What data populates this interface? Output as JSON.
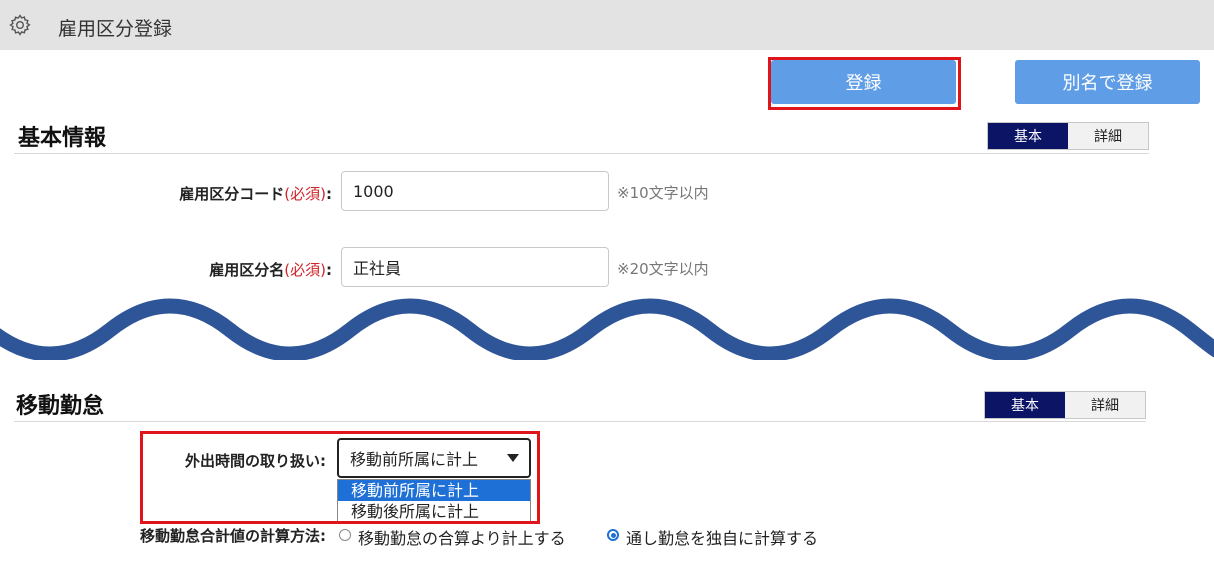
{
  "header": {
    "title": "雇用区分登録",
    "icon": "gear-icon"
  },
  "toolbar": {
    "register_label": "登録",
    "register_alias_label": "別名で登録"
  },
  "basic_info": {
    "title": "基本情報",
    "toggle": {
      "basic": "基本",
      "detail": "詳細",
      "selected": "基本"
    },
    "code": {
      "label": "雇用区分コード",
      "required": "(必須)",
      "colon": ":",
      "value": "1000",
      "hint": "※10文字以内"
    },
    "name": {
      "label": "雇用区分名",
      "required": "(必須)",
      "colon": ":",
      "value": "正社員",
      "hint": "※20文字以内"
    }
  },
  "travel_attendance": {
    "title": "移動勤怠",
    "toggle": {
      "basic": "基本",
      "detail": "詳細",
      "selected": "基本"
    },
    "outing": {
      "label": "外出時間の取り扱い:",
      "value": "移動前所属に計上",
      "options": [
        "移動前所属に計上",
        "移動後所属に計上"
      ]
    },
    "calc_method": {
      "label": "移動勤怠合計値の計算方法:",
      "options": [
        "移動勤怠の合算より計上する",
        "通し勤怠を独自に計算する"
      ],
      "selected_index": 1
    }
  },
  "colors": {
    "accent_button": "#5f9de6",
    "toggle_active": "#0c1565",
    "highlight": "#e0141b",
    "wave": "#2e5597"
  }
}
